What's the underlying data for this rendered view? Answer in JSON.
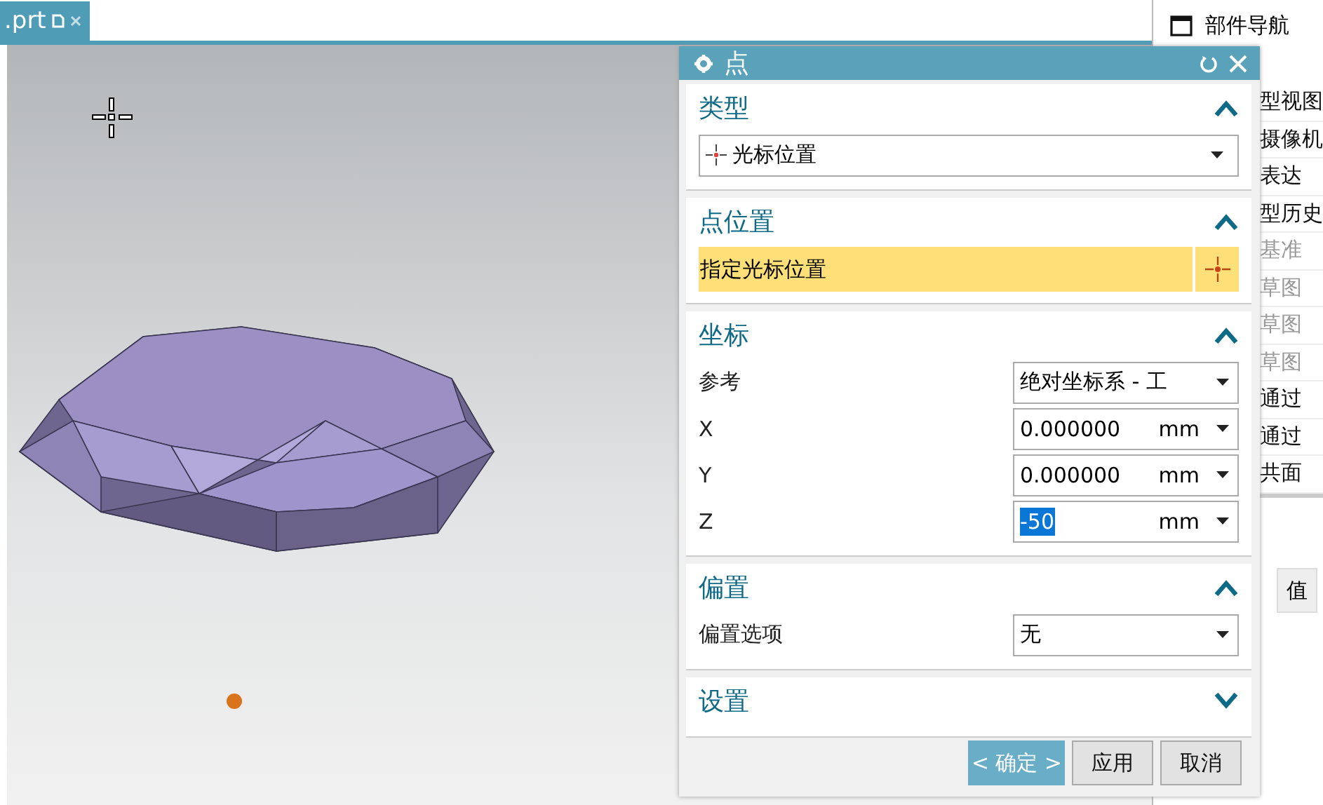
{
  "document_tab": {
    "label": ".prt",
    "selected": true
  },
  "dialog": {
    "title": "点",
    "sections": [
      {
        "title": "类型",
        "expanded": true,
        "rows": [
          {
            "kind": "dropdown",
            "value": "光标位置"
          }
        ]
      },
      {
        "title": "点位置",
        "expanded": true,
        "rows": [
          {
            "kind": "selection",
            "label": "指定光标位置",
            "selected": true
          }
        ]
      },
      {
        "title": "坐标",
        "expanded": true,
        "rows": [
          {
            "kind": "select",
            "label": "参考",
            "value": "绝对坐标系 - 工"
          },
          {
            "kind": "number",
            "label": "X",
            "value": "0.000000",
            "unit": "mm",
            "selected": false
          },
          {
            "kind": "number",
            "label": "Y",
            "value": "0.000000",
            "unit": "mm",
            "selected": false
          },
          {
            "kind": "number",
            "label": "Z",
            "value": "-50",
            "unit": "mm",
            "selected": true
          }
        ]
      },
      {
        "title": "偏置",
        "expanded": true,
        "rows": [
          {
            "kind": "select",
            "label": "偏置选项",
            "value": "无"
          }
        ]
      },
      {
        "title": "设置",
        "expanded": false
      }
    ],
    "buttons": [
      {
        "label": "< 确定 >",
        "kind": "default"
      },
      {
        "label": "应用",
        "kind": "normal"
      },
      {
        "label": "取消",
        "kind": "normal"
      }
    ]
  },
  "navigator": {
    "title": "部件导航",
    "items": [
      {
        "label": "型视图",
        "disabled": false
      },
      {
        "label": "摄像机",
        "disabled": false
      },
      {
        "label": "表达",
        "disabled": false
      },
      {
        "label": "型历史",
        "disabled": false
      },
      {
        "label": "基准",
        "disabled": true
      },
      {
        "label": "草图",
        "disabled": true
      },
      {
        "label": "草图",
        "disabled": true
      },
      {
        "label": "草图",
        "disabled": true
      },
      {
        "label": "通过",
        "disabled": false
      },
      {
        "label": "通过",
        "disabled": false
      },
      {
        "label": "共面",
        "disabled": false
      }
    ],
    "column": "值"
  }
}
